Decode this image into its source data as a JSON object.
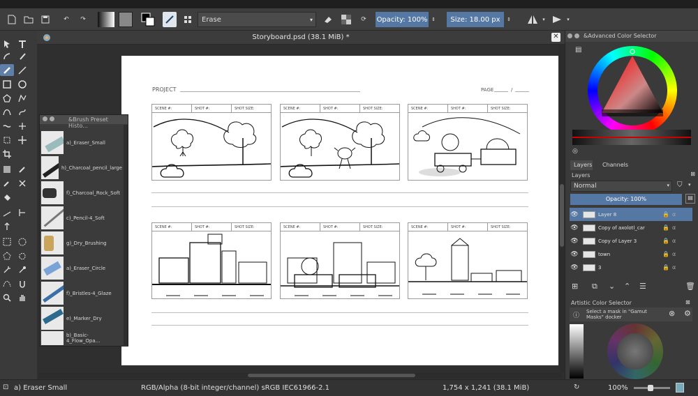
{
  "toolbar": {
    "blend_mode": "Erase",
    "opacity_label": "Opacity: 100%",
    "size_label": "Size: 18.00 px"
  },
  "document": {
    "tab_title": "Storyboard.psd (38.1 MiB) *",
    "header_left": "PROJECT",
    "header_right": "PAGE",
    "header_right_sep": "/",
    "frame_labels": [
      "SCENE #:",
      "SHOT #:",
      "SHOT SIZE:"
    ]
  },
  "brush_presets": {
    "title": "&Brush Preset Histo...",
    "items": [
      {
        "label": "a)_Eraser_Small",
        "selected": true
      },
      {
        "label": "h)_Charcoal_pencil_large",
        "selected": false
      },
      {
        "label": "f)_Charcoal_Rock_Soft",
        "selected": false
      },
      {
        "label": "c)_Pencil-4_Soft",
        "selected": false
      },
      {
        "label": "g)_Dry_Brushing",
        "selected": false
      },
      {
        "label": "a)_Eraser_Circle",
        "selected": false
      },
      {
        "label": "f)_Bristles-4_Glaze",
        "selected": false
      },
      {
        "label": "e)_Marker_Dry",
        "selected": false
      },
      {
        "label": "b)_Basic-4_Flow_Opa...",
        "selected": false
      }
    ]
  },
  "color_selector": {
    "title": "&Advanced Color Selector"
  },
  "layers": {
    "tabs": [
      "Layers",
      "Channels"
    ],
    "panel_title": "Layers",
    "blend": "Normal",
    "opacity": "Opacity:  100%",
    "items": [
      {
        "name": "Layer 8",
        "selected": true
      },
      {
        "name": "Copy of axolotl_car",
        "selected": false
      },
      {
        "name": "Copy of Layer 3",
        "selected": false
      },
      {
        "name": "town",
        "selected": false
      },
      {
        "name": "3",
        "selected": false
      }
    ]
  },
  "artistic_selector": {
    "title": "Artistic Color Selector",
    "hint": "Select a mask in \"Gamut Masks\" docker"
  },
  "status": {
    "brush": "a) Eraser Small",
    "colorspace": "RGB/Alpha (8-bit integer/channel)  sRGB IEC61966-2.1",
    "dimensions": "1,754 x 1,241 (38.1 MiB)",
    "zoom": "100%"
  },
  "colors": {
    "accent": "#5577a3",
    "bg": "#3a3a3a"
  }
}
